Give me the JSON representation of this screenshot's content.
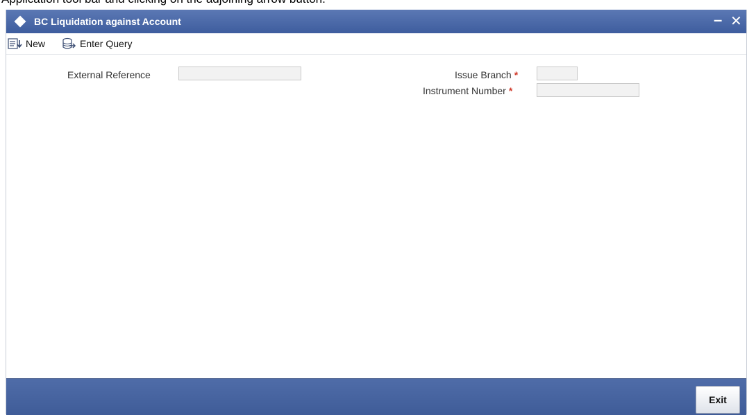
{
  "document": {
    "caption": "Application tool bar and clicking on the adjoining arrow button."
  },
  "window": {
    "title": "BC Liquidation against Account",
    "minimize_glyph": "–",
    "close_glyph": "✕"
  },
  "toolbar": {
    "new_label": "New",
    "enter_query_label": "Enter Query",
    "new_icon": "new-document-icon",
    "query_icon": "enter-query-icon"
  },
  "form": {
    "external_reference": {
      "label": "External Reference",
      "value": ""
    },
    "issue_branch": {
      "label": "Issue Branch",
      "required": "*",
      "value": ""
    },
    "instrument_number": {
      "label": "Instrument Number",
      "required": "*",
      "value": ""
    }
  },
  "footer": {
    "exit_label": "Exit"
  },
  "colors": {
    "titlebar": "#4a68a8",
    "footer": "#4a66a2",
    "required": "#d03a2a"
  }
}
